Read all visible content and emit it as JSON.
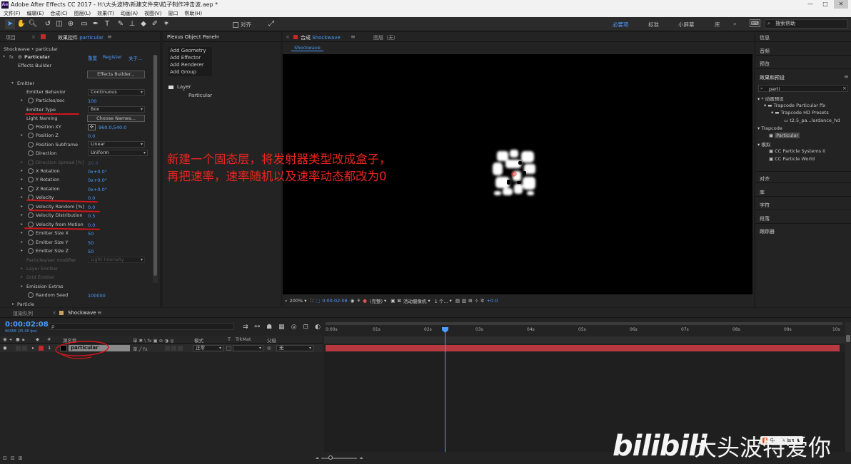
{
  "window": {
    "title": "Adobe After Effects CC 2017 - H:\\大头波特\\新建文件夹\\粒子制作冲击波.aep *",
    "logo": "Ae",
    "minimize": "—",
    "maximize": "□",
    "close": "✕"
  },
  "menu": [
    "文件(F)",
    "编辑(E)",
    "合成(C)",
    "图层(L)",
    "效果(T)",
    "动画(A)",
    "视图(V)",
    "窗口",
    "帮助(H)"
  ],
  "toolbar": {
    "align_label": "对齐",
    "workspaces": [
      "必要项",
      "标准",
      "小屏幕",
      "库"
    ],
    "search_help": "搜索帮助"
  },
  "project_panel": {
    "tab_project": "项目",
    "tab_effect_controls": "效果控件",
    "effect_layer": "particular",
    "breadcrumb": "Shockwave • particular",
    "effect_name": "Particular",
    "reset": "重置",
    "register": "Register",
    "about": "关于...",
    "effects_builder_label": "Effects Builder",
    "effects_builder_button": "Effects Builder...",
    "emitter_group": "Emitter",
    "props": {
      "emitter_behavior": {
        "label": "Emitter Behavior",
        "value": "Continuous"
      },
      "particles_sec": {
        "label": "Particles/sec",
        "value": "100"
      },
      "emitter_type": {
        "label": "Emitter Type",
        "value": "Box"
      },
      "light_naming": {
        "label": "Light Naming",
        "value": "Choose Names..."
      },
      "position_xy": {
        "label": "Position XY",
        "value": "960.0,540.0"
      },
      "position_z": {
        "label": "Position Z",
        "value": "0.0"
      },
      "position_subframe": {
        "label": "Position Subframe",
        "value": "Linear"
      },
      "direction": {
        "label": "Direction",
        "value": "Uniform"
      },
      "direction_spread": {
        "label": "Direction Spread [%]",
        "value": "20.0"
      },
      "x_rotation": {
        "label": "X Rotation",
        "value": "0x+0.0°"
      },
      "y_rotation": {
        "label": "Y Rotation",
        "value": "0x+0.0°"
      },
      "z_rotation": {
        "label": "Z Rotation",
        "value": "0x+0.0°"
      },
      "velocity": {
        "label": "Velocity",
        "value": "0.0"
      },
      "velocity_random": {
        "label": "Velocity Random [%]",
        "value": "0.0"
      },
      "velocity_distribution": {
        "label": "Velocity Distribution",
        "value": "0.5"
      },
      "velocity_from_motion": {
        "label": "Velocity from Motion",
        "value": "0.0"
      },
      "emitter_size_x": {
        "label": "Emitter Size X",
        "value": "50"
      },
      "emitter_size_y": {
        "label": "Emitter Size Y",
        "value": "50"
      },
      "emitter_size_z": {
        "label": "Emitter Size Z",
        "value": "50"
      },
      "particles_modifier": {
        "label": "Particles/sec modifier",
        "value": "Light Intensity"
      },
      "layer_emitter": {
        "label": "Layer Emitter"
      },
      "grid_emitter": {
        "label": "Grid Emitter"
      },
      "emission_extras": {
        "label": "Emission Extras"
      },
      "random_seed": {
        "label": "Random Seed",
        "value": "100000"
      },
      "particle": {
        "label": "Particle"
      }
    }
  },
  "plexus_panel": {
    "title": "Plexus Object Panel",
    "menu": [
      "Add Geometry",
      "Add Effector",
      "Add Renderer",
      "Add Group"
    ],
    "tree_root": "Layer",
    "tree_child": "Particular"
  },
  "comp_panel": {
    "tab_comp_prefix": "合成",
    "tab_comp_name": "Shockwave",
    "tab_layer": "图层（无）",
    "sub_tab": "Shockwave",
    "annotation_line1": "新建一个固态层，将发射器类型改成盒子，",
    "annotation_line2": "再把速率，速率随机以及速率动态都改为0",
    "zoom": "200%",
    "timecode": "0:00:02:08",
    "quality": "(完整)",
    "camera": "活动摄像机",
    "views": "1 个...",
    "exposure": "+0.0"
  },
  "right_panel": {
    "items_top": [
      "信息",
      "音频",
      "预览"
    ],
    "effects_title": "效果和预设",
    "search_value": "parti",
    "tree": {
      "animation_presets": "* 动画预设",
      "trapcode_ffx": "Trapcode Particular ffx",
      "trapcode_hd": "Trapcode HD Presets",
      "preset_file": "t2.5_pa...lardance_hd",
      "trapcode": "Trapcode",
      "particular": "Particular",
      "simulate": "模拟",
      "cc_systems": "CC Particle Systems II",
      "cc_world": "CC Particle World"
    },
    "items_bottom": [
      "对齐",
      "库",
      "字符",
      "段落",
      "跟踪器"
    ]
  },
  "timeline": {
    "tab_render": "渲染队列",
    "tab_comp": "Shockwave",
    "timecode": "0:00:02:08",
    "fps": "00058 (25.00 fps)",
    "search_placeholder": "ρ",
    "col_number": "#",
    "col_source": "源名称",
    "col_mode": "模式",
    "col_t": "T",
    "col_trkmat": "TrkMat",
    "col_parent": "父级",
    "layer": {
      "index": "1",
      "name": "particular",
      "mode": "正常",
      "parent": "无"
    },
    "ruler": [
      "0:00s",
      "01s",
      "02s",
      "03s",
      "04s",
      "05s",
      "06s",
      "07s",
      "08s",
      "09s",
      "10s"
    ],
    "playhead_seconds": 2.32,
    "duration_seconds": 10
  },
  "watermark": {
    "site": "bilibili",
    "author": "大头波特爱你"
  },
  "colors": {
    "accent_blue": "#4c9cff",
    "annotation_red": "#e8251f",
    "layer_bar": "#b8383f"
  }
}
